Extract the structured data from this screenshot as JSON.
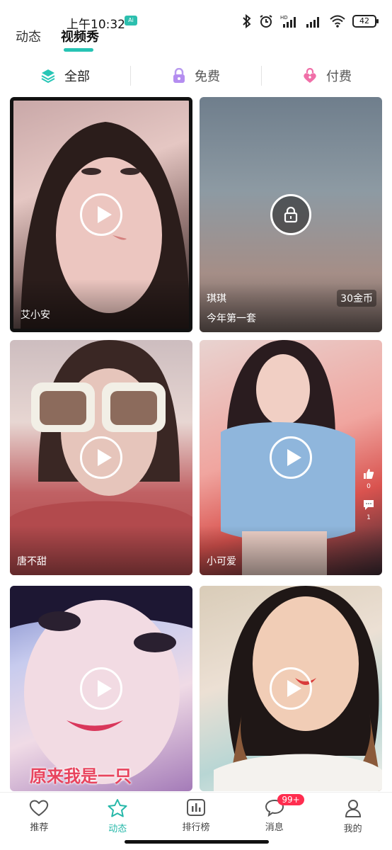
{
  "status_bar": {
    "time": "上午10:32",
    "badge": "Ai",
    "battery": "42",
    "hd": "HD"
  },
  "top_tabs": [
    {
      "label": "动态",
      "active": false
    },
    {
      "label": "视频秀",
      "active": true
    }
  ],
  "filters": [
    {
      "label": "全部",
      "icon": "layers-icon",
      "active": true
    },
    {
      "label": "免费",
      "icon": "lock-icon",
      "active": false
    },
    {
      "label": "付费",
      "icon": "heart-lock-icon",
      "active": false
    }
  ],
  "cards": [
    {
      "name": "艾小安",
      "locked": false,
      "colors": [
        "#d9b7b8",
        "#3a2a2a"
      ]
    },
    {
      "name": "今年第一套",
      "title": "琪琪",
      "price": "30金币",
      "locked": true,
      "colors": [
        "#7b8a96",
        "#b08e84"
      ]
    },
    {
      "name": "唐不甜",
      "locked": false,
      "colors": [
        "#c7b0b3",
        "#b24a4d"
      ]
    },
    {
      "name": "小可爱",
      "locked": false,
      "colors": [
        "#f2a6a0",
        "#8fb6dc"
      ],
      "side": {
        "likes": "0",
        "comments": "1"
      }
    },
    {
      "name": "",
      "overlay": "原来我是一只",
      "locked": false,
      "colors": [
        "#b7bde6",
        "#e6c6d8"
      ]
    },
    {
      "name": "",
      "locked": false,
      "colors": [
        "#d8c2b4",
        "#8a5a3a"
      ]
    }
  ],
  "bottom_nav": [
    {
      "label": "推荐",
      "icon": "heart-icon",
      "active": false
    },
    {
      "label": "动态",
      "icon": "star-icon",
      "active": true
    },
    {
      "label": "排行榜",
      "icon": "chart-icon",
      "active": false
    },
    {
      "label": "消息",
      "icon": "message-icon",
      "active": false,
      "badge": "99+"
    },
    {
      "label": "我的",
      "icon": "user-icon",
      "active": false
    }
  ],
  "colors": {
    "accent": "#26c3b4",
    "badge_red": "#ff2d4f"
  }
}
